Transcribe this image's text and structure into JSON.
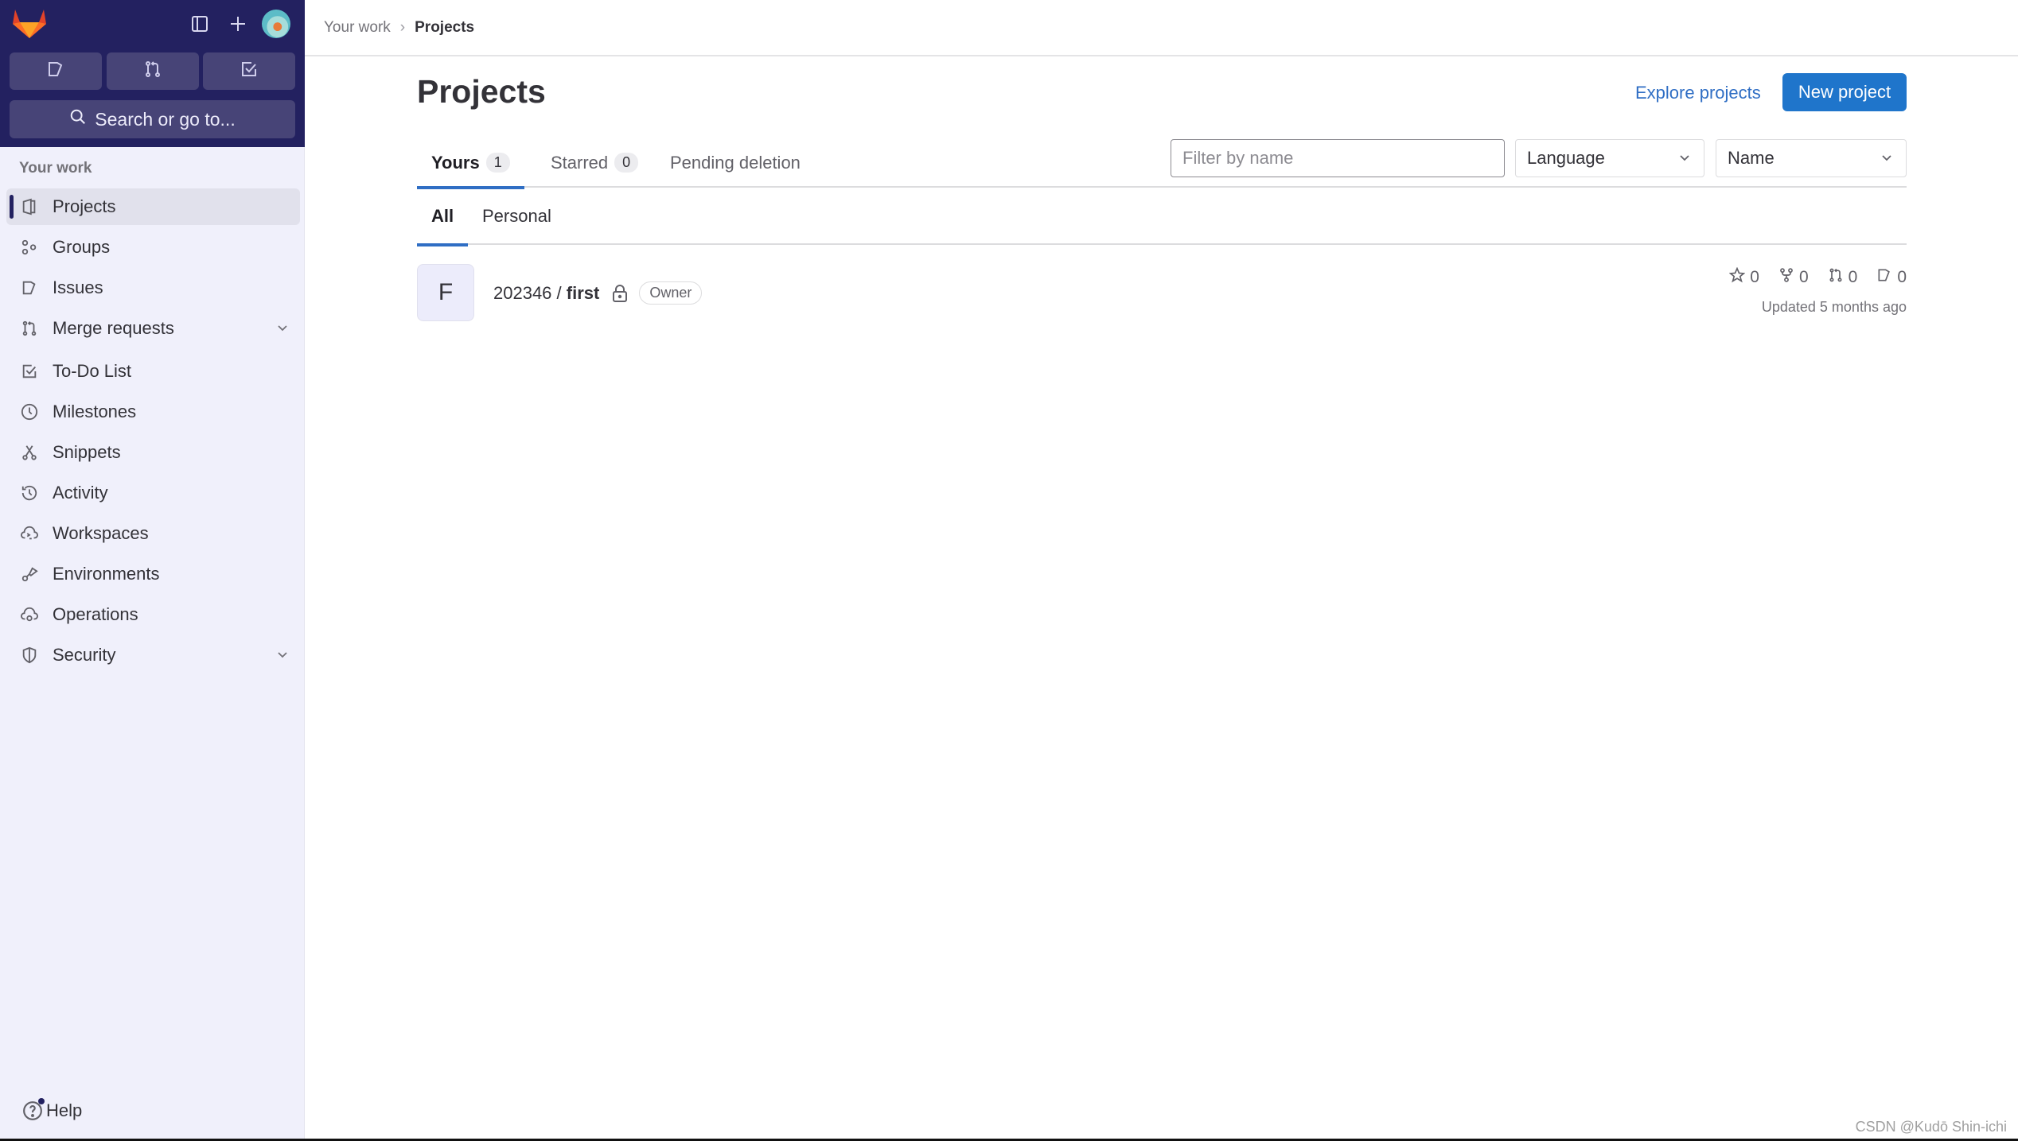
{
  "sidebar": {
    "top_icons": {
      "toggle_sidebar": "sidebar-toggle-icon",
      "create_new": "plus-icon",
      "avatar": "user-avatar"
    },
    "quick_actions": [
      {
        "name": "issues",
        "icon": "issues-icon"
      },
      {
        "name": "merge-requests",
        "icon": "merge-request-icon"
      },
      {
        "name": "todos",
        "icon": "todo-icon"
      }
    ],
    "search_label": "Search or go to...",
    "section_label": "Your work",
    "items": [
      {
        "label": "Projects",
        "icon": "project-icon",
        "active": true
      },
      {
        "label": "Groups",
        "icon": "group-icon"
      },
      {
        "label": "Issues",
        "icon": "issues-icon"
      },
      {
        "label": "Merge requests",
        "icon": "merge-request-icon",
        "expandable": true
      },
      {
        "label": "To-Do List",
        "icon": "todo-icon"
      },
      {
        "label": "Milestones",
        "icon": "clock-icon"
      },
      {
        "label": "Snippets",
        "icon": "snippet-icon"
      },
      {
        "label": "Activity",
        "icon": "history-icon"
      },
      {
        "label": "Workspaces",
        "icon": "cloud-terminal-icon"
      },
      {
        "label": "Environments",
        "icon": "environment-icon"
      },
      {
        "label": "Operations",
        "icon": "cloud-gear-icon"
      },
      {
        "label": "Security",
        "icon": "shield-icon",
        "expandable": true
      }
    ],
    "help_label": "Help"
  },
  "breadcrumb": {
    "parent": "Your work",
    "separator": "›",
    "current": "Projects"
  },
  "header": {
    "title": "Projects",
    "explore_label": "Explore projects",
    "new_project_label": "New project"
  },
  "tabs": [
    {
      "label": "Yours",
      "count": "1",
      "active": true
    },
    {
      "label": "Starred",
      "count": "0"
    },
    {
      "label": "Pending deletion"
    }
  ],
  "filters": {
    "search_placeholder": "Filter by name",
    "search_value": "",
    "language_selected": "Language",
    "sort_selected": "Name"
  },
  "subtabs": [
    {
      "label": "All",
      "active": true
    },
    {
      "label": "Personal"
    }
  ],
  "projects": [
    {
      "avatar_letter": "F",
      "namespace": "202346",
      "separator": " / ",
      "name": "first",
      "visibility": "private",
      "role": "Owner",
      "stars": "0",
      "forks": "0",
      "merge_requests": "0",
      "issues": "0",
      "updated": "Updated 5 months ago"
    }
  ],
  "watermark": "CSDN @Kudō Shin-ichi",
  "colors": {
    "sidebar_dark": "#232160",
    "sidebar_bg": "#f0f0fb",
    "primary": "#1f75cb",
    "link": "#2f6ec4"
  }
}
